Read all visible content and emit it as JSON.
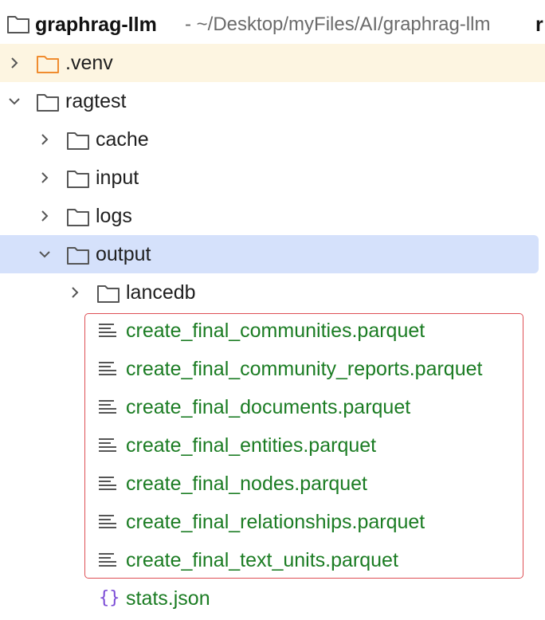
{
  "root": {
    "name": "graphrag-llm",
    "path": "- ~/Desktop/myFiles/AI/graphrag-llm",
    "trailing": "r"
  },
  "tree": {
    "venv": ".venv",
    "ragtest": "ragtest",
    "cache": "cache",
    "input": "input",
    "logs": "logs",
    "output": "output",
    "lancedb": "lancedb",
    "files": [
      "create_final_communities.parquet",
      "create_final_community_reports.parquet",
      "create_final_documents.parquet",
      "create_final_entities.parquet",
      "create_final_nodes.parquet",
      "create_final_relationships.parquet",
      "create_final_text_units.parquet"
    ],
    "stats": "stats.json",
    "stats_icon": "{}"
  },
  "colors": {
    "venv_highlight": "#fdf5e1",
    "selection": "#d5e1fb",
    "file_text_green": "#1b7c23",
    "box_red": "#de4f55",
    "json_icon_purple": "#7b4bd6",
    "venv_folder_orange": "#f08c2f"
  }
}
